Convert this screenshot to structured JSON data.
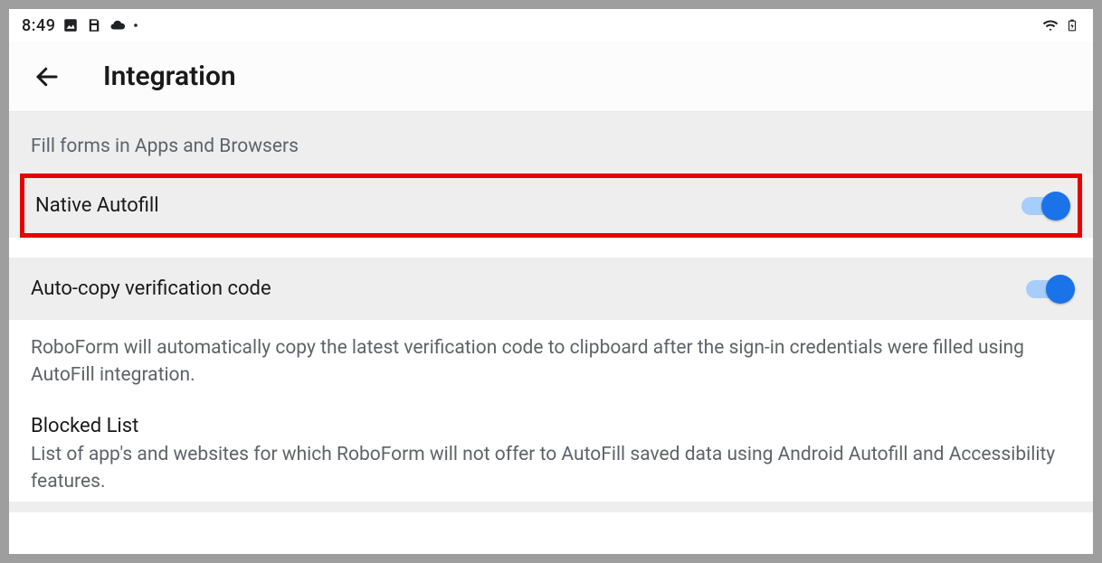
{
  "statusbar": {
    "time": "8:49"
  },
  "appbar": {
    "title": "Integration"
  },
  "section1": {
    "header": "Fill forms in Apps and Browsers",
    "native_autofill_label": "Native Autofill",
    "native_autofill_on": true
  },
  "section2": {
    "autocopy_label": "Auto-copy verification code",
    "autocopy_on": true,
    "autocopy_desc": "RoboForm will automatically copy the latest verification code to clipboard after the sign-in credentials were filled using AutoFill integration.",
    "blocked_title": "Blocked List",
    "blocked_desc": "List of app's and websites for which RoboForm will not offer to AutoFill saved data using Android Autofill and Accessibility features."
  }
}
